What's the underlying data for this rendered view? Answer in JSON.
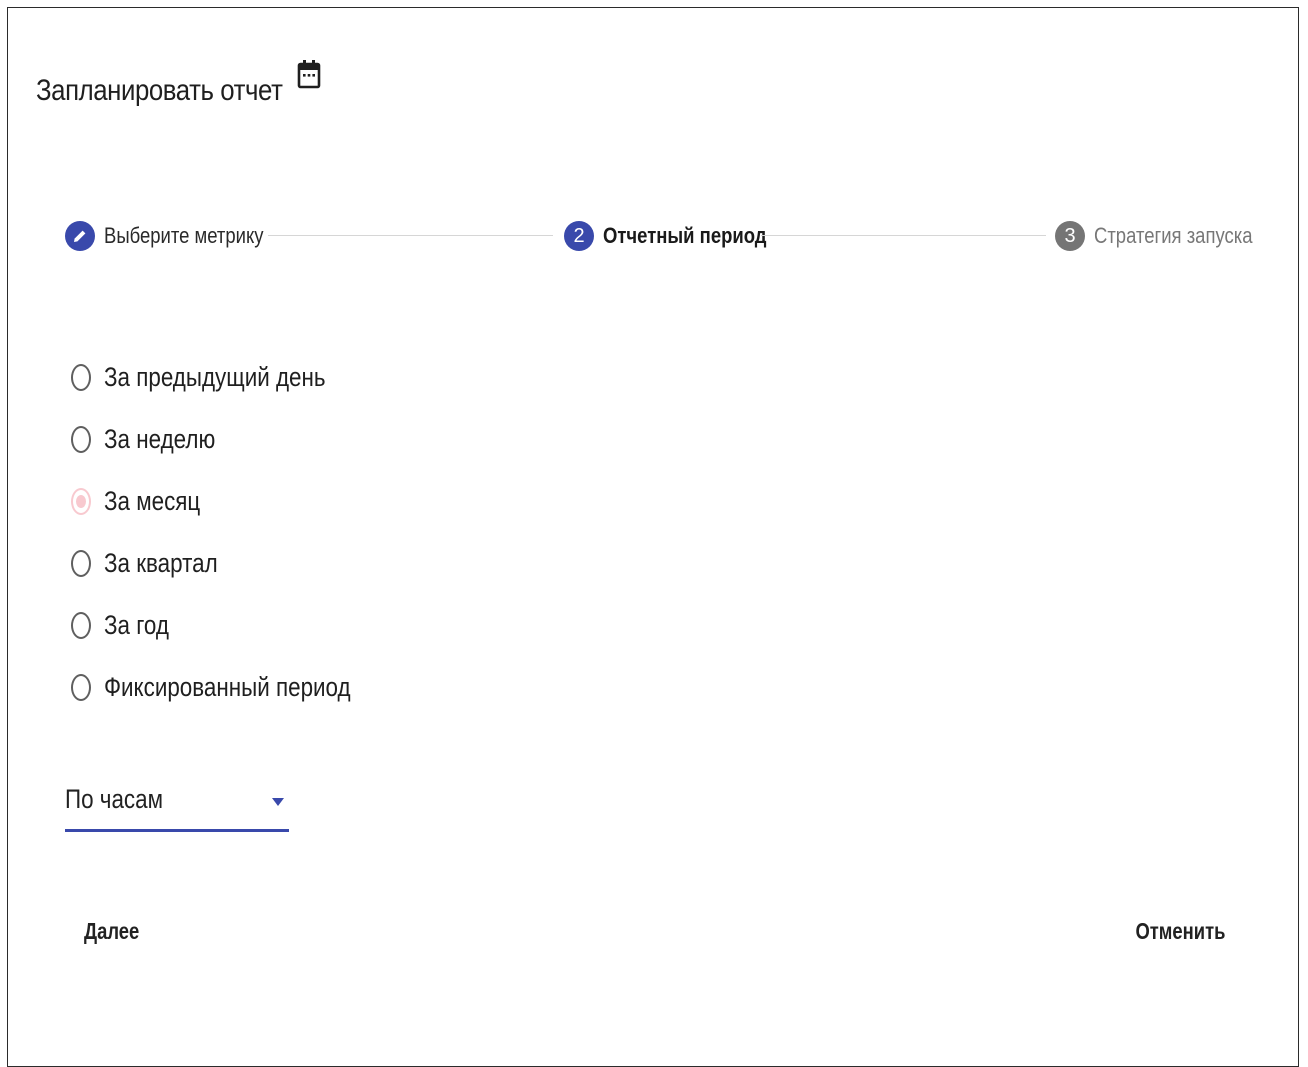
{
  "dialog": {
    "title": "Запланировать отчет",
    "title_icon": "calendar-icon"
  },
  "stepper": {
    "steps": [
      {
        "label": "Выберите метрику",
        "indicator": "",
        "state": "done",
        "icon": "pencil-icon"
      },
      {
        "label": "Отчетный период",
        "indicator": "2",
        "state": "active"
      },
      {
        "label": "Стратегия запуска",
        "indicator": "3",
        "state": "pending"
      }
    ]
  },
  "period": {
    "options": [
      {
        "label": "За предыдущий день",
        "checked": false
      },
      {
        "label": "За неделю",
        "checked": false
      },
      {
        "label": "За месяц",
        "checked": true
      },
      {
        "label": "За квартал",
        "checked": false
      },
      {
        "label": "За год",
        "checked": false
      },
      {
        "label": "Фиксированный период",
        "checked": false
      }
    ],
    "selected": "За месяц"
  },
  "granularity_select": {
    "value": "По часам"
  },
  "actions": {
    "next_label": "Далее",
    "cancel_label": "Отменить"
  },
  "colors": {
    "accent": "#3949ab",
    "pending": "#757575",
    "radio_checked": "#f8c9cf"
  }
}
